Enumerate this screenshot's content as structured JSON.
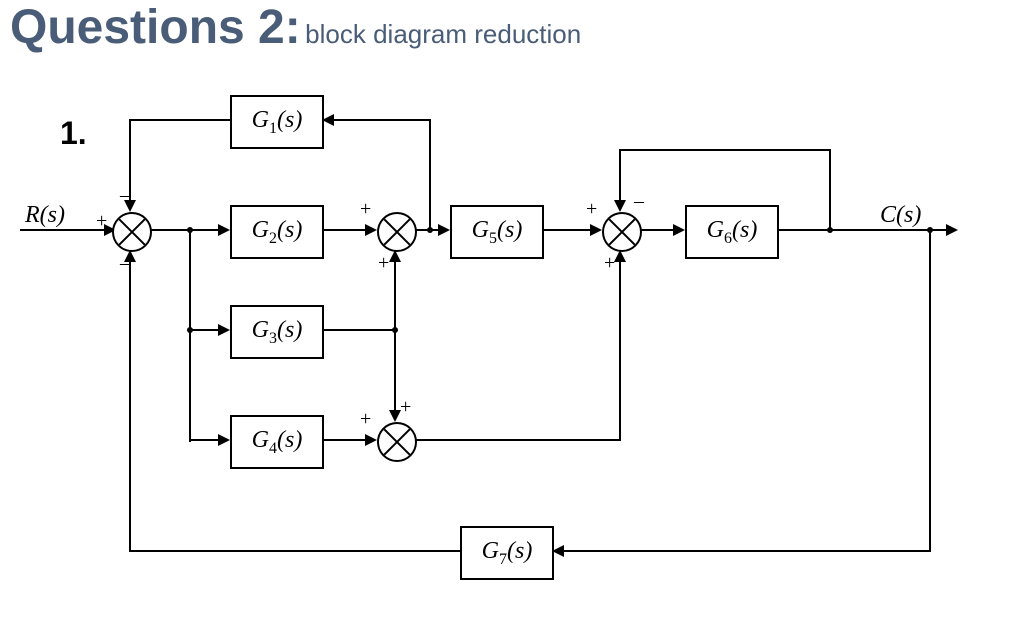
{
  "heading": {
    "main": "Questions 2:",
    "sub": "block diagram reduction"
  },
  "question_number": "1.",
  "signals": {
    "input": "R(s)",
    "output": "C(s)"
  },
  "blocks": {
    "g1": "G1(s)",
    "g2": "G2(s)",
    "g3": "G3(s)",
    "g4": "G4(s)",
    "g5": "G5(s)",
    "g6": "G6(s)",
    "g7": "G7(s)"
  },
  "summing_junctions": {
    "s1": {
      "top": "–",
      "left": "+",
      "bottom": "–"
    },
    "s2": {
      "top": "+",
      "bottom": "+"
    },
    "s3": {
      "top": "+",
      "bottom": "+"
    },
    "s4": {
      "top": "–",
      "left": "+",
      "bottom": "+"
    }
  }
}
